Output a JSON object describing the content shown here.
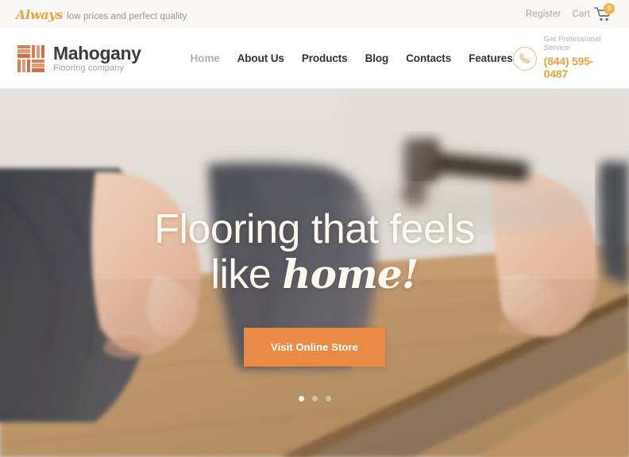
{
  "topbar": {
    "tagline_script": "Always",
    "tagline_text": "low prices and perfect quality",
    "register_label": "Register",
    "cart_label": "Cart",
    "cart_count": "0",
    "cart_icon": "shopping-cart-icon"
  },
  "brand": {
    "name": "Mahogany",
    "subtitle": "Flooring company",
    "logo_icon": "parquet-logo-icon"
  },
  "nav": {
    "items": [
      {
        "label": "Home",
        "active": true
      },
      {
        "label": "About Us",
        "active": false
      },
      {
        "label": "Products",
        "active": false
      },
      {
        "label": "Blog",
        "active": false
      },
      {
        "label": "Contacts",
        "active": false
      },
      {
        "label": "Features",
        "active": false
      }
    ]
  },
  "phone": {
    "icon": "phone-handset-icon",
    "label": "Get Professional Service",
    "number": "(844) 595-0487"
  },
  "hero": {
    "headline_line1": "Flooring that feels",
    "headline_line2_plain": "like ",
    "headline_line2_script": "home!",
    "cta_label": "Visit Online Store",
    "slides": [
      {
        "index": "1",
        "active": true
      },
      {
        "index": "2",
        "active": false
      },
      {
        "index": "3",
        "active": false
      }
    ],
    "background_description": "person installing wooden flooring plank with mallet"
  },
  "colors": {
    "accent_orange": "#e98b45",
    "gold": "#e8a33d",
    "logo_terracotta": "#d9805a",
    "topbar_bg": "#faf8f5",
    "nav_bg": "#ffffff",
    "hero_text": "#fdf9f1"
  }
}
